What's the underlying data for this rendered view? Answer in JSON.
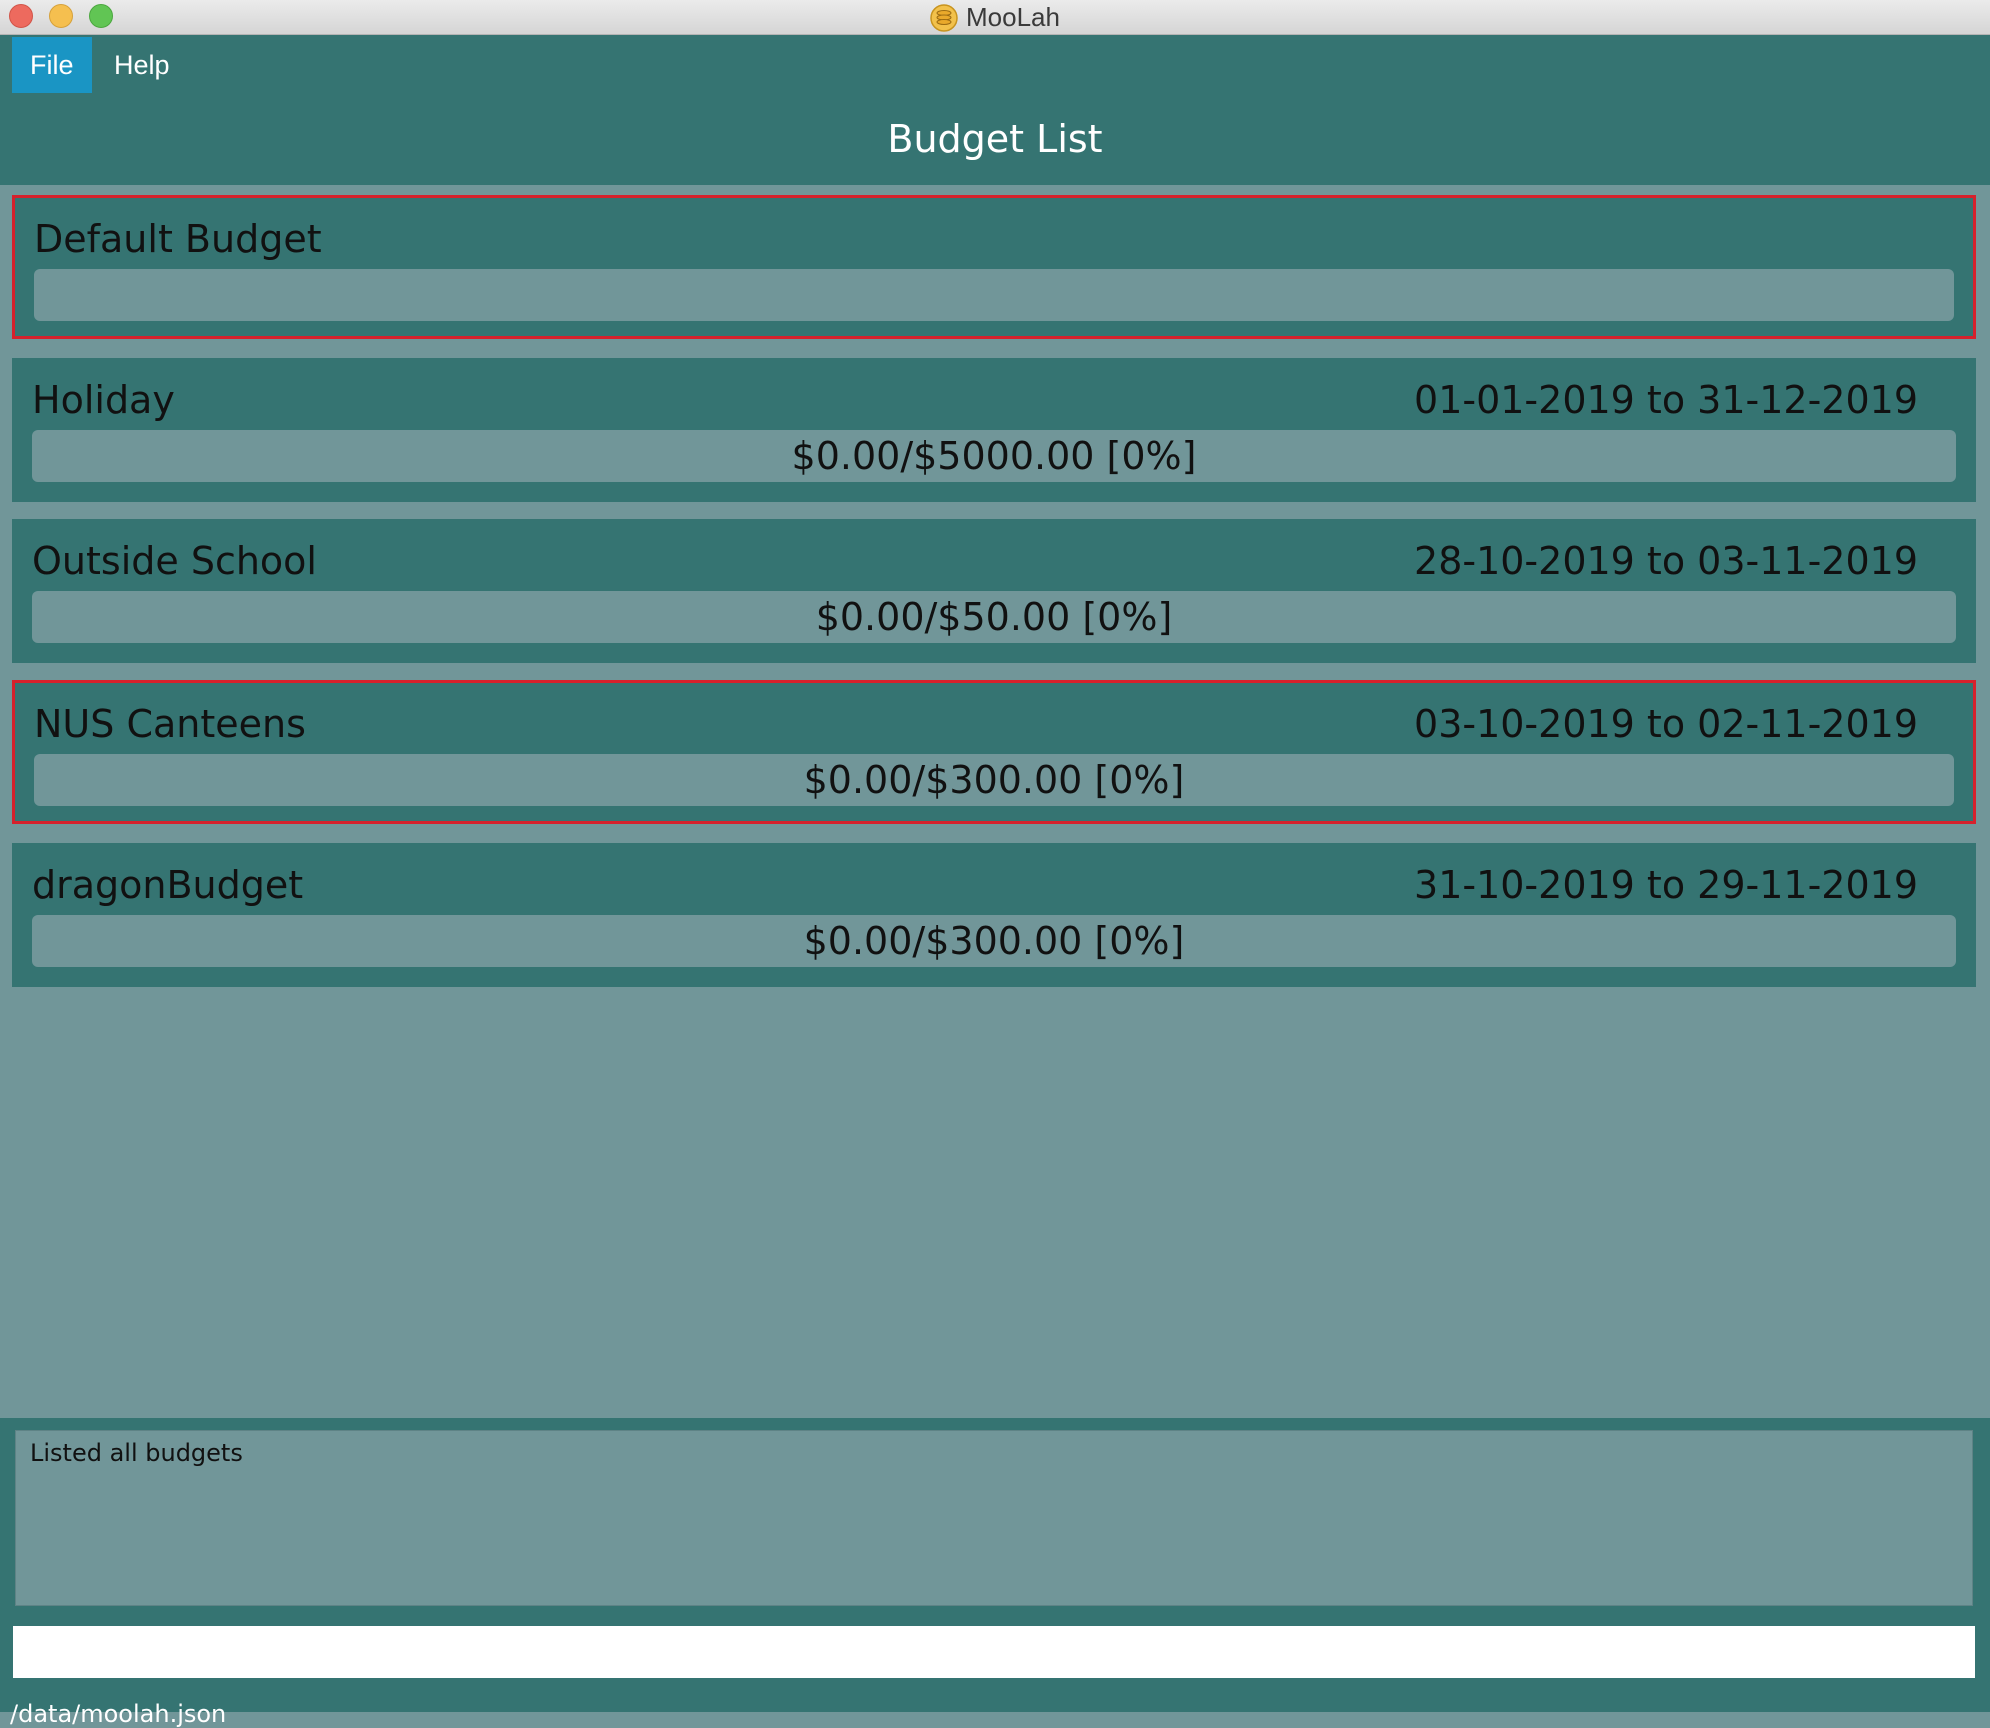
{
  "window": {
    "title": "MooLah",
    "app_icon": "coins-icon"
  },
  "menu": {
    "file": "File",
    "help": "Help"
  },
  "header": {
    "title": "Budget List"
  },
  "budgets": [
    {
      "name": "Default Budget",
      "period": "",
      "progress_text": "",
      "selected": true
    },
    {
      "name": "Holiday",
      "period": "01-01-2019 to 31-12-2019",
      "progress_text": "$0.00/$5000.00 [0%]",
      "selected": false
    },
    {
      "name": "Outside School",
      "period": "28-10-2019 to 03-11-2019",
      "progress_text": "$0.00/$50.00 [0%]",
      "selected": false
    },
    {
      "name": "NUS Canteens",
      "period": "03-10-2019 to 02-11-2019",
      "progress_text": "$0.00/$300.00 [0%]",
      "selected": true
    },
    {
      "name": "dragonBudget",
      "period": "31-10-2019 to 29-11-2019",
      "progress_text": "$0.00/$300.00 [0%]",
      "selected": false
    }
  ],
  "result": {
    "message": "Listed all budgets"
  },
  "command": {
    "value": ""
  },
  "status": {
    "path": "/data/moolah.json"
  },
  "colors": {
    "panel": "#357472",
    "background": "#719699",
    "menu_highlight": "#1a95c4",
    "selected_border": "#d6212c"
  }
}
